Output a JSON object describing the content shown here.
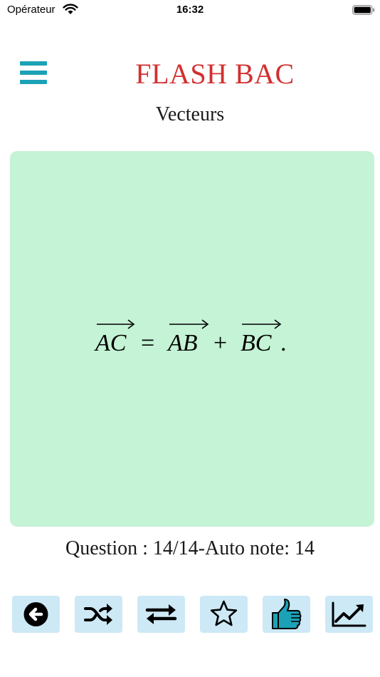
{
  "status_bar": {
    "carrier": "Opérateur",
    "time": "16:32",
    "wifi_icon": "wifi-icon",
    "battery_icon": "battery-full-icon"
  },
  "header": {
    "menu_icon": "hamburger-menu-icon",
    "app_title": "FLASH BAC",
    "chapter": "Vecteurs",
    "colors": {
      "title": "#d22f2f",
      "menu": "#1ba2b6",
      "card": "#c4f3d5",
      "toolbar_button": "#cde9f6",
      "thumb": "#1ba2b6"
    }
  },
  "card": {
    "formula": {
      "lhs": "AC",
      "eq": "=",
      "term1": "AB",
      "plus": "+",
      "term2": "BC",
      "end": "."
    }
  },
  "progress": {
    "text": "Question : 14/14-Auto note: 14"
  },
  "toolbar": {
    "buttons": [
      {
        "icon": "back-arrow-circle-icon"
      },
      {
        "icon": "shuffle-icon"
      },
      {
        "icon": "swap-arrows-icon"
      },
      {
        "icon": "star-outline-icon"
      },
      {
        "icon": "thumbs-up-icon"
      },
      {
        "icon": "chart-line-icon"
      }
    ]
  }
}
